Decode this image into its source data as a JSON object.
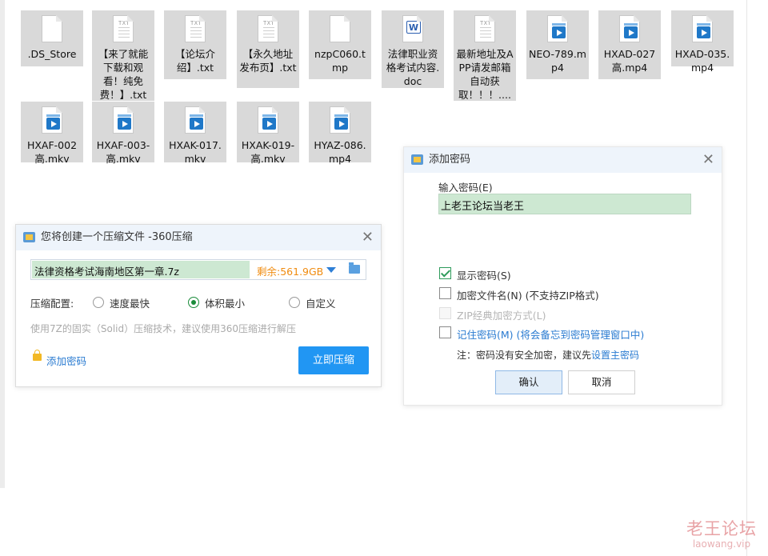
{
  "files": [
    {
      "name": ".DS_Store",
      "type": "blank"
    },
    {
      "name": "【来了就能下载和观看！纯免费！】.txt",
      "type": "txt"
    },
    {
      "name": "【论坛介绍】.txt",
      "type": "txt"
    },
    {
      "name": "【永久地址发布页】.txt",
      "type": "txt"
    },
    {
      "name": "nzpC060.tmp",
      "type": "blank"
    },
    {
      "name": "法律职业资格考试内容.doc",
      "type": "doc"
    },
    {
      "name": "最新地址及APP请发邮箱自动获取！！！....",
      "type": "txt"
    },
    {
      "name": "NEO-789.mp4",
      "type": "video"
    },
    {
      "name": "HXAD-027高.mp4",
      "type": "video"
    },
    {
      "name": "HXAD-035.mp4",
      "type": "video"
    },
    {
      "name": "HXAF-002高.mkv",
      "type": "video"
    },
    {
      "name": "HXAF-003-高.mkv",
      "type": "video"
    },
    {
      "name": "HXAK-017.mkv",
      "type": "video"
    },
    {
      "name": "HXAK-019-高.mkv",
      "type": "video"
    },
    {
      "name": "HYAZ-086.mp4",
      "type": "video"
    }
  ],
  "icon_text": {
    "txt": "TXT",
    "doc": "W"
  },
  "compress_dialog": {
    "title": "您将创建一个压缩文件 -360压缩",
    "filename": "法律资格考试海南地区第一章.7z",
    "free_space": "剩余:561.9GB",
    "config_label": "压缩配置:",
    "options": [
      "速度最快",
      "体积最小",
      "自定义"
    ],
    "selected_option": "体积最小",
    "hint": "使用7Z的固实（Solid）压缩技术，建议使用360压缩进行解压",
    "add_password": "添加密码",
    "compress_button": "立即压缩"
  },
  "password_dialog": {
    "title": "添加密码",
    "input_label": "输入密码(E)",
    "password_value": "上老王论坛当老王",
    "show_password": "显示密码(S)",
    "encrypt_filenames": "加密文件名(N) (不支持ZIP格式)",
    "zip_classic": "ZIP经典加密方式(L)",
    "remember_password": "记住密码(M) (将会备忘到密码管理窗口中)",
    "note_prefix": "注：密码没有安全加密，建议先",
    "note_link": "设置主密码",
    "ok_button": "确认",
    "cancel_button": "取消"
  },
  "watermark": {
    "title": "老王论坛",
    "url": "laowang.vip"
  },
  "colors": {
    "accent": "#2196f3",
    "selection": "#d9d9d9",
    "input_fill": "#cde8d2",
    "free_space": "#f08c10"
  }
}
